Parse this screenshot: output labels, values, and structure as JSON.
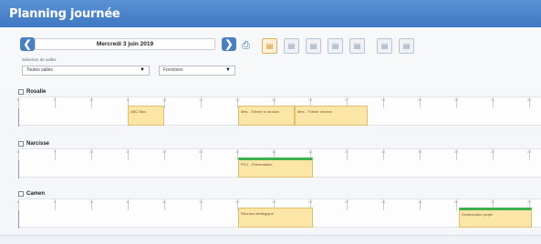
{
  "title": "Planning journée",
  "toolbar": {
    "date": "Mercredi 3 juin 2019",
    "prev_icon": "chevron-left-icon",
    "next_icon": "chevron-right-icon",
    "filter_label": "Sélection de salles",
    "room_filter": "Toutes salles",
    "extra_filter": "Fonctions",
    "accent": "#4a7fc4"
  },
  "hours": [
    "8",
    "9",
    "10",
    "11",
    "12",
    "13",
    "14",
    "15",
    "16",
    "17",
    "18",
    "19",
    "20",
    "21",
    "22"
  ],
  "rooms": [
    {
      "name": "Rosalie",
      "events": [
        {
          "label": "ABC Bloc",
          "color": "yellow"
        },
        {
          "label": "Mes - Thème la réunion",
          "color": "yellow"
        },
        {
          "label": "Mes - Thème réunion",
          "color": "yellow"
        }
      ]
    },
    {
      "name": "Narcisse",
      "events": [
        {
          "label": "PCC - Présentation",
          "color": "green"
        }
      ]
    },
    {
      "name": "Camen",
      "events": [
        {
          "label": "Réunion stratégique",
          "color": "yellow"
        },
        {
          "label": "Gestionnaire projet",
          "color": "green"
        }
      ]
    }
  ]
}
